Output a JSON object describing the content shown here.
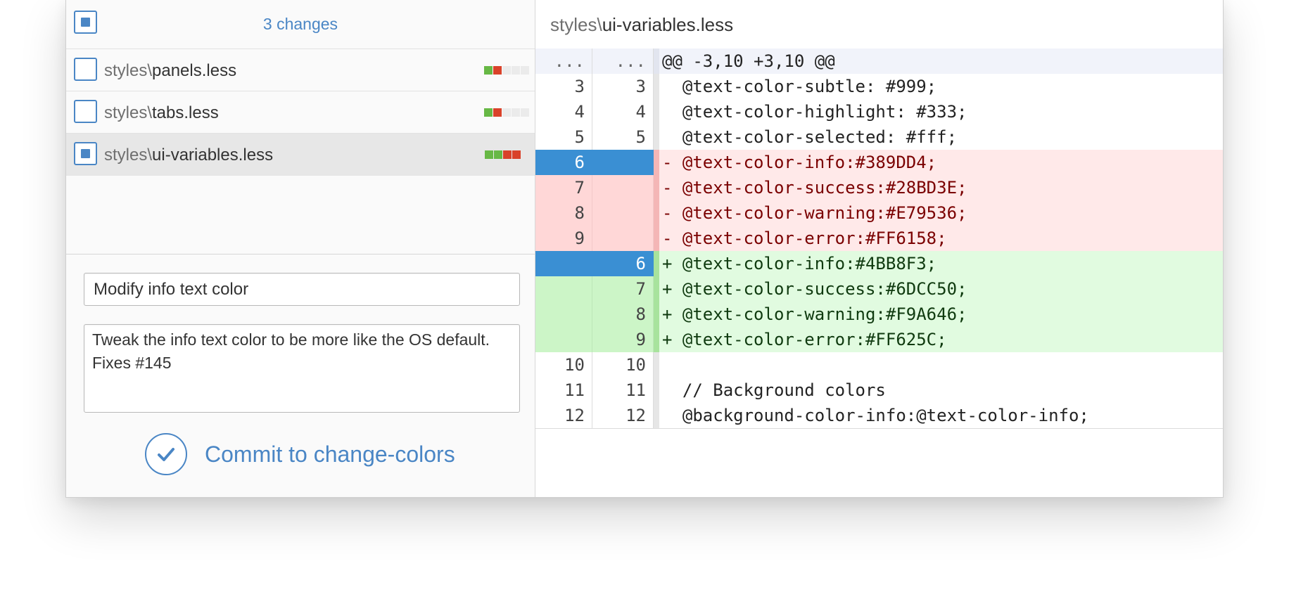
{
  "changes_panel": {
    "count_label": "3 changes",
    "files": [
      {
        "dir": "styles\\",
        "name": "panels.less",
        "selected": false,
        "diffstat": [
          "add",
          "del",
          "none",
          "none",
          "none"
        ]
      },
      {
        "dir": "styles\\",
        "name": "tabs.less",
        "selected": false,
        "diffstat": [
          "add",
          "del",
          "none",
          "none",
          "none"
        ]
      },
      {
        "dir": "styles\\",
        "name": "ui-variables.less",
        "selected": true,
        "diffstat": [
          "add",
          "add",
          "del",
          "del"
        ]
      }
    ]
  },
  "commit_form": {
    "summary_value": "Modify info text color",
    "description_value": "Tweak the info text color to be more like the OS default.\nFixes #145",
    "commit_label": "Commit to change-colors"
  },
  "diff": {
    "path_dir": "styles\\",
    "path_file": "ui-variables.less",
    "hunk": {
      "old": "...",
      "new": "...",
      "text": "@@ -3,10 +3,10 @@"
    },
    "lines": [
      {
        "type": "ctx",
        "old": "3",
        "new": "3",
        "text": "  @text-color-subtle: #999;"
      },
      {
        "type": "ctx",
        "old": "4",
        "new": "4",
        "text": "  @text-color-highlight: #333;"
      },
      {
        "type": "ctx",
        "old": "5",
        "new": "5",
        "text": "  @text-color-selected: #fff;"
      },
      {
        "type": "del",
        "old": "6",
        "new": "",
        "text": "- @text-color-info:#389DD4;",
        "selected": true
      },
      {
        "type": "del",
        "old": "7",
        "new": "",
        "text": "- @text-color-success:#28BD3E;"
      },
      {
        "type": "del",
        "old": "8",
        "new": "",
        "text": "- @text-color-warning:#E79536;"
      },
      {
        "type": "del",
        "old": "9",
        "new": "",
        "text": "- @text-color-error:#FF6158;"
      },
      {
        "type": "add",
        "old": "",
        "new": "6",
        "text": "+ @text-color-info:#4BB8F3;",
        "selected": true
      },
      {
        "type": "add",
        "old": "",
        "new": "7",
        "text": "+ @text-color-success:#6DCC50;"
      },
      {
        "type": "add",
        "old": "",
        "new": "8",
        "text": "+ @text-color-warning:#F9A646;"
      },
      {
        "type": "add",
        "old": "",
        "new": "9",
        "text": "+ @text-color-error:#FF625C;"
      },
      {
        "type": "ctx",
        "old": "10",
        "new": "10",
        "text": ""
      },
      {
        "type": "ctx",
        "old": "11",
        "new": "11",
        "text": "  // Background colors"
      },
      {
        "type": "ctx",
        "old": "12",
        "new": "12",
        "text": "  @background-color-info:@text-color-info;"
      }
    ]
  },
  "colors": {
    "accent": "#4a86c5",
    "selection": "#3a8fd3",
    "added": "#67b845",
    "deleted": "#d9422a"
  }
}
